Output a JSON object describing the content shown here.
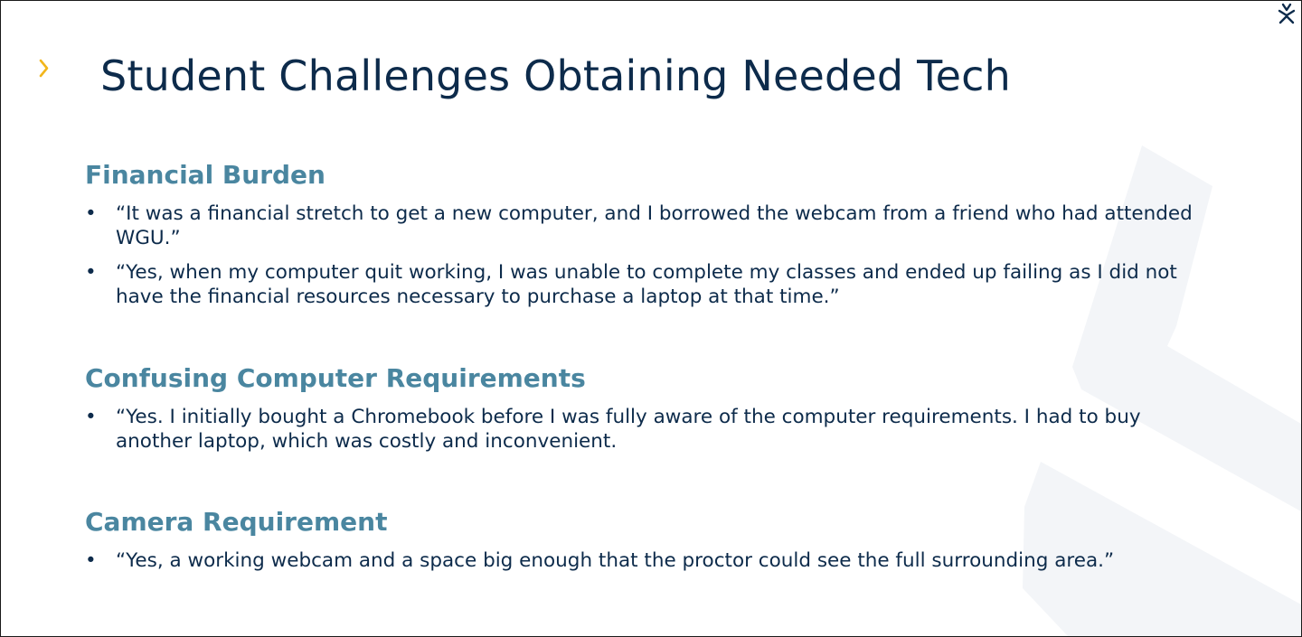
{
  "slide": {
    "title": "Student Challenges Obtaining Needed Tech",
    "bullet_glyph": "•",
    "sections": [
      {
        "heading": "Financial Burden",
        "bullets": [
          "“It was a financial stretch to get a new computer, and I borrowed the webcam from a friend who had attended WGU.”",
          "“Yes, when my computer quit working, I was unable to complete my classes and ended up failing as I did not have the financial resources necessary to purchase a laptop at that time.”"
        ]
      },
      {
        "heading": "Confusing Computer Requirements",
        "bullets": [
          "“Yes. I initially bought a Chromebook before I was fully aware of the computer requirements. I had to buy another laptop, which was costly and inconvenient."
        ]
      },
      {
        "heading": "Camera Requirement",
        "bullets": [
          "“Yes, a working webcam and a space big enough that the proctor could see the full surrounding area.”"
        ]
      }
    ]
  },
  "icons": {
    "accent_chevron": "chevron-right-icon",
    "brand_logo": "brand-logo-icon"
  },
  "colors": {
    "title": "#0d2b4b",
    "heading": "#4a86a0",
    "body_text": "#0d2b4b",
    "accent": "#f2b61c",
    "watermark": "#f3f5f8",
    "border": "#1a1a1a"
  }
}
